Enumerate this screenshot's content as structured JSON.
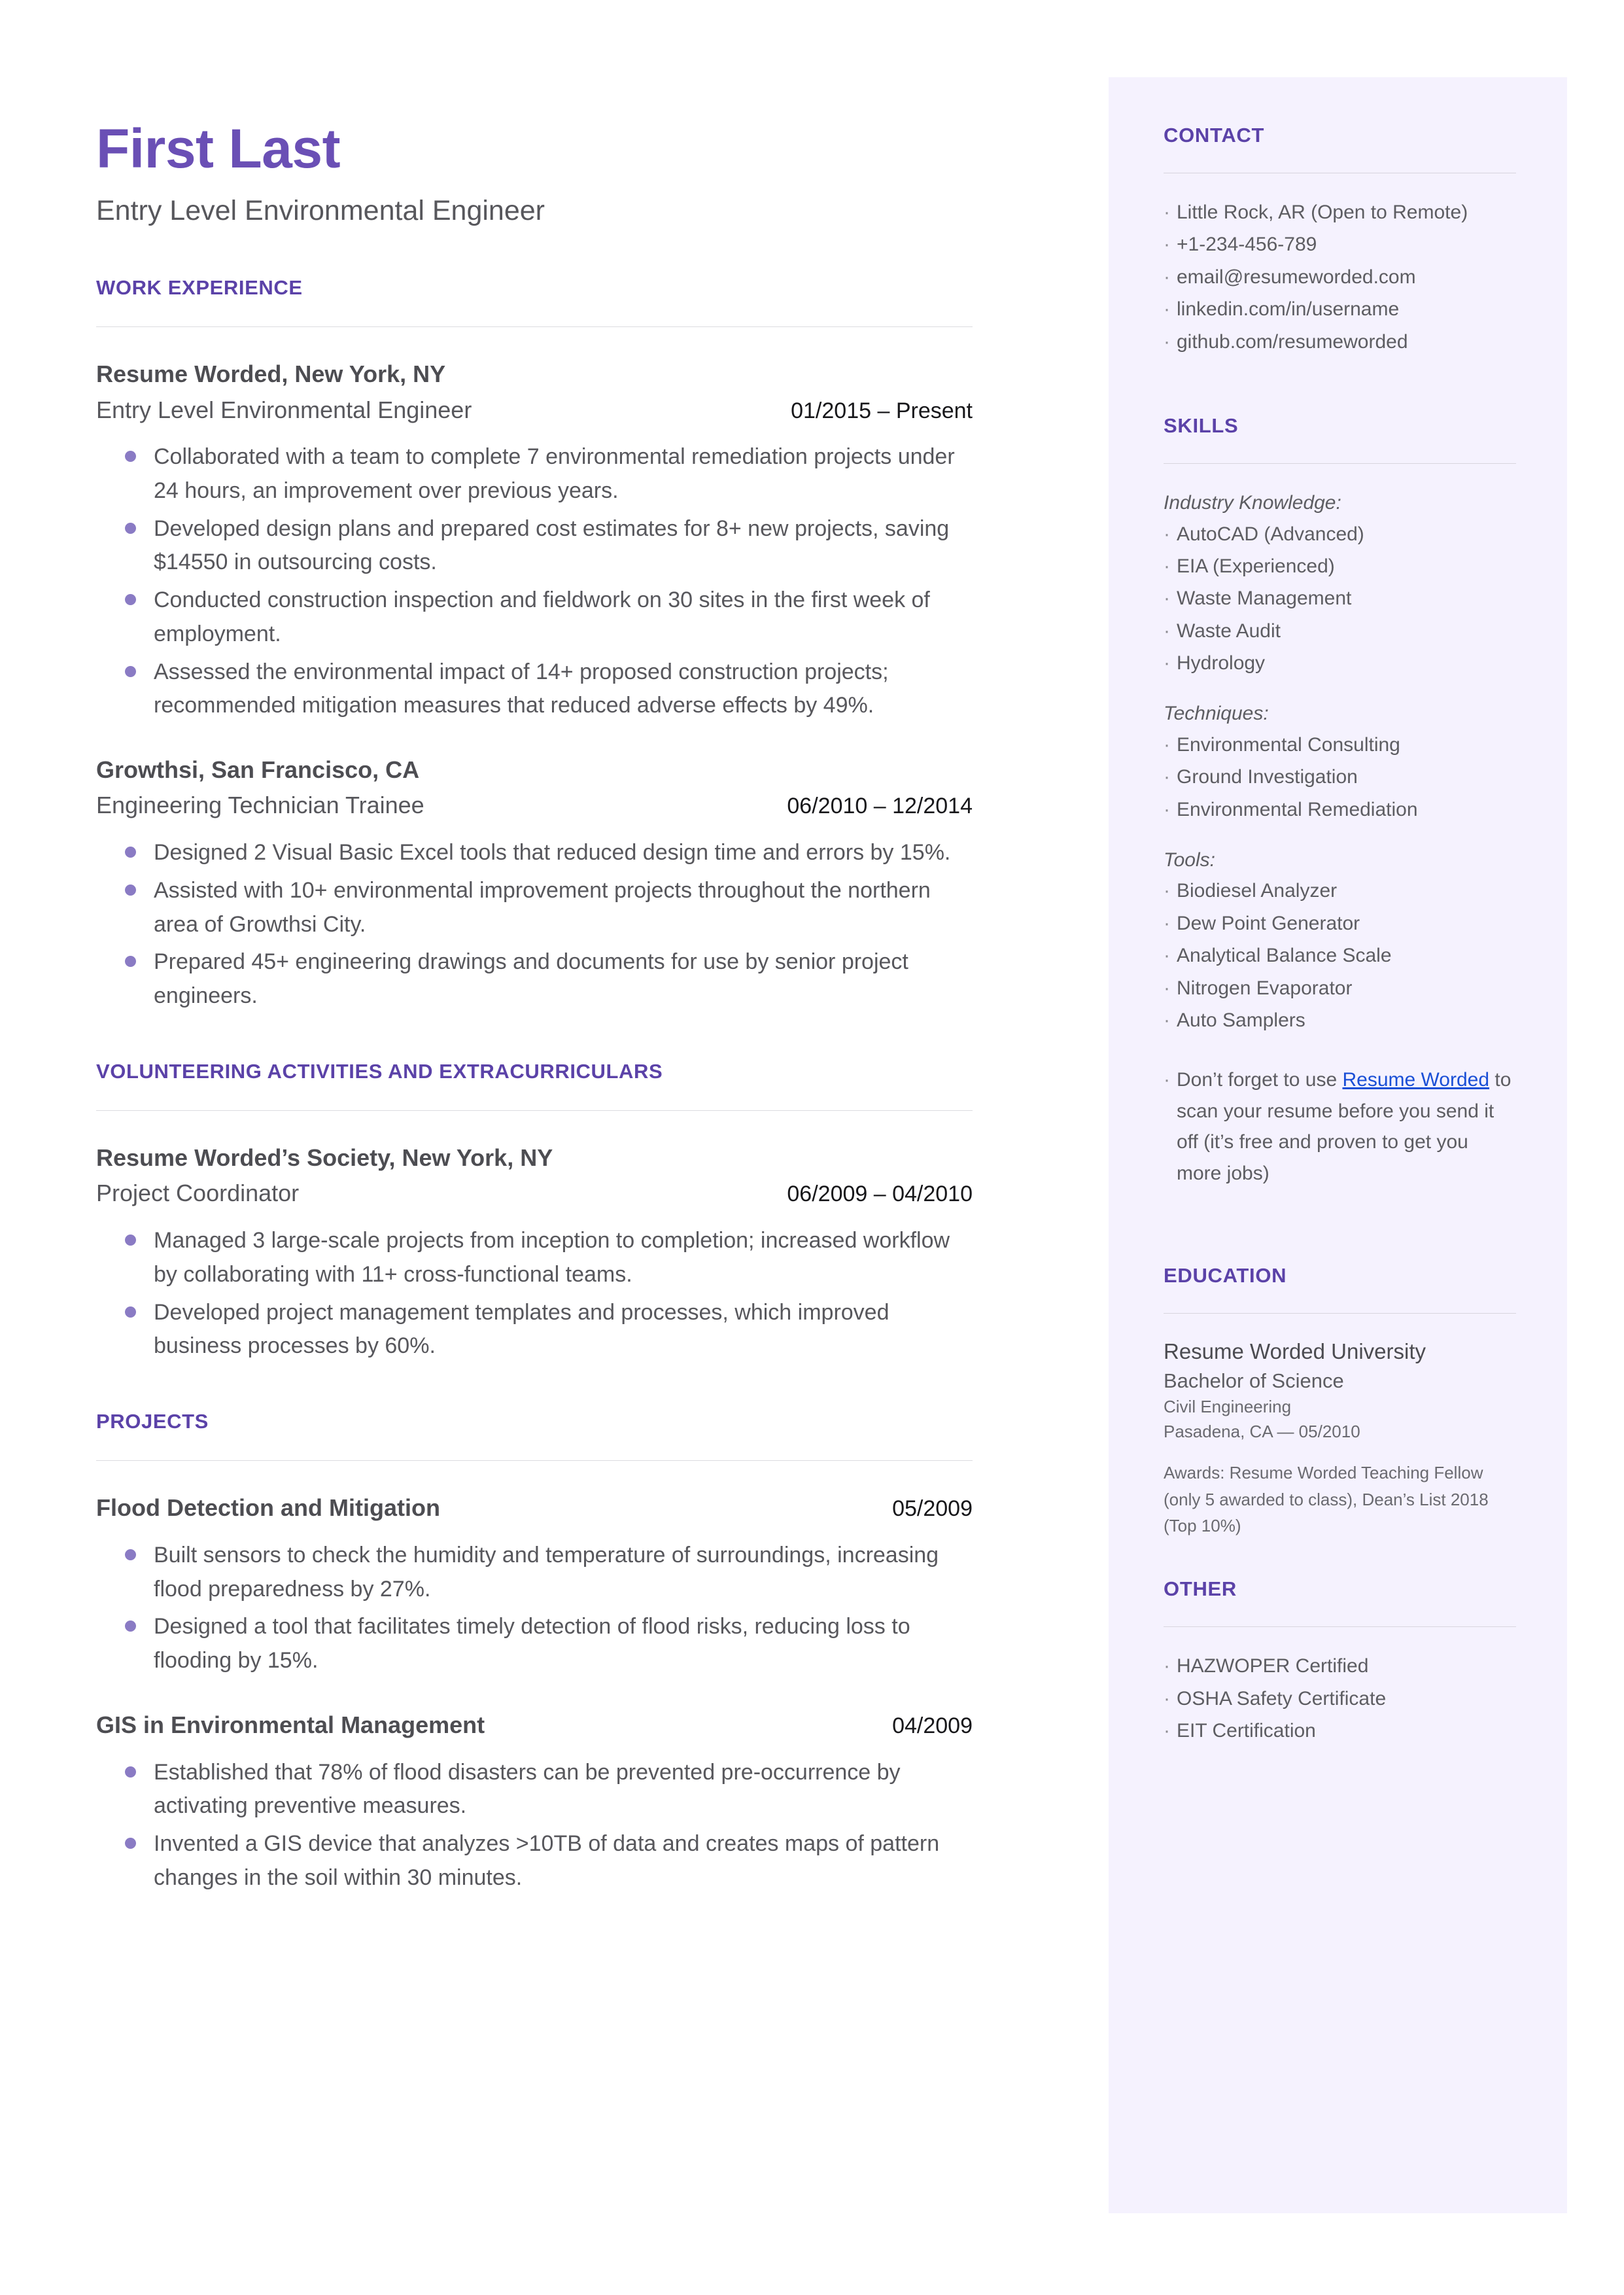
{
  "colors": {
    "accent_purple": "#5b42a8",
    "name_purple": "#6a4fb5",
    "bullet_purple": "#8a7bc4",
    "sidebar_bg": "#f5f2fe",
    "body_text": "#57575c",
    "link_blue": "#1a4fd6"
  },
  "header": {
    "name": "First Last",
    "title": "Entry Level Environmental Engineer"
  },
  "sections": {
    "work_experience": {
      "heading": "WORK EXPERIENCE",
      "entries": [
        {
          "organization": "Resume Worded, New York, NY",
          "role": "Entry Level Environmental Engineer",
          "dates": "01/2015 – Present",
          "bullets": [
            "Collaborated with a team to complete 7 environmental remediation projects under 24 hours, an improvement over previous years.",
            "Developed design plans and prepared cost estimates for 8+ new projects, saving $14550 in outsourcing costs.",
            "Conducted construction inspection and fieldwork on 30 sites in the first week of employment.",
            "Assessed the environmental impact of 14+ proposed construction projects; recommended mitigation measures that reduced adverse effects by 49%."
          ]
        },
        {
          "organization": "Growthsi, San Francisco, CA",
          "role": "Engineering Technician Trainee",
          "dates": "06/2010 – 12/2014",
          "bullets": [
            "Designed 2 Visual Basic Excel tools that reduced design time and errors by 15%.",
            "Assisted with 10+ environmental improvement projects throughout the northern area of Growthsi City.",
            "Prepared 45+ engineering drawings and documents for use by senior project engineers."
          ]
        }
      ]
    },
    "volunteering": {
      "heading": "VOLUNTEERING ACTIVITIES AND EXTRACURRICULARS",
      "entries": [
        {
          "organization": "Resume Worded’s Society, New York, NY",
          "role": "Project Coordinator",
          "dates": "06/2009 – 04/2010",
          "bullets": [
            "Managed 3 large-scale projects from inception to completion; increased workflow by collaborating with 11+ cross-functional teams.",
            "Developed project management templates and processes, which improved business processes by 60%."
          ]
        }
      ]
    },
    "projects": {
      "heading": "PROJECTS",
      "entries": [
        {
          "title": "Flood Detection and Mitigation",
          "dates": "05/2009",
          "bullets": [
            "Built sensors to check the humidity and temperature of surroundings, increasing flood preparedness by 27%.",
            "Designed a tool that facilitates timely detection of flood risks, reducing loss to flooding by 15%."
          ]
        },
        {
          "title": "GIS in Environmental Management",
          "dates": "04/2009",
          "bullets": [
            "Established that 78% of flood disasters can be prevented pre-occurrence by activating preventive measures.",
            "Invented a GIS device that analyzes >10TB of data and creates maps of pattern changes in the soil within 30 minutes."
          ]
        }
      ]
    }
  },
  "sidebar": {
    "contact": {
      "heading": "CONTACT",
      "items": [
        "Little Rock, AR (Open to Remote)",
        "+1-234-456-789",
        "email@resumeworded.com",
        "linkedin.com/in/username",
        "github.com/resumeworded"
      ]
    },
    "skills": {
      "heading": "SKILLS",
      "groups": [
        {
          "label": "Industry Knowledge:",
          "items": [
            "AutoCAD (Advanced)",
            "EIA (Experienced)",
            "Waste Management",
            "Waste Audit",
            "Hydrology"
          ]
        },
        {
          "label": "Techniques:",
          "items": [
            "Environmental Consulting",
            "Ground Investigation",
            "Environmental Remediation"
          ]
        },
        {
          "label": "Tools:",
          "items": [
            "Biodiesel Analyzer",
            "Dew Point Generator",
            "Analytical Balance Scale",
            "Nitrogen Evaporator",
            "Auto Samplers"
          ]
        }
      ],
      "promo": {
        "before": "Don’t forget to use ",
        "link": "Resume Worded",
        "after": " to scan your resume before you send it off (it’s free and proven to get you more jobs)"
      }
    },
    "education": {
      "heading": "EDUCATION",
      "school": "Resume Worded University",
      "degree": "Bachelor of Science",
      "major": "Civil Engineering",
      "location_date": "Pasadena, CA — 05/2010",
      "awards": "Awards: Resume Worded Teaching Fellow (only 5 awarded to class), Dean’s List 2018 (Top 10%)"
    },
    "other": {
      "heading": "OTHER",
      "items": [
        "HAZWOPER Certified",
        "OSHA Safety Certificate",
        "EIT Certification"
      ]
    }
  }
}
